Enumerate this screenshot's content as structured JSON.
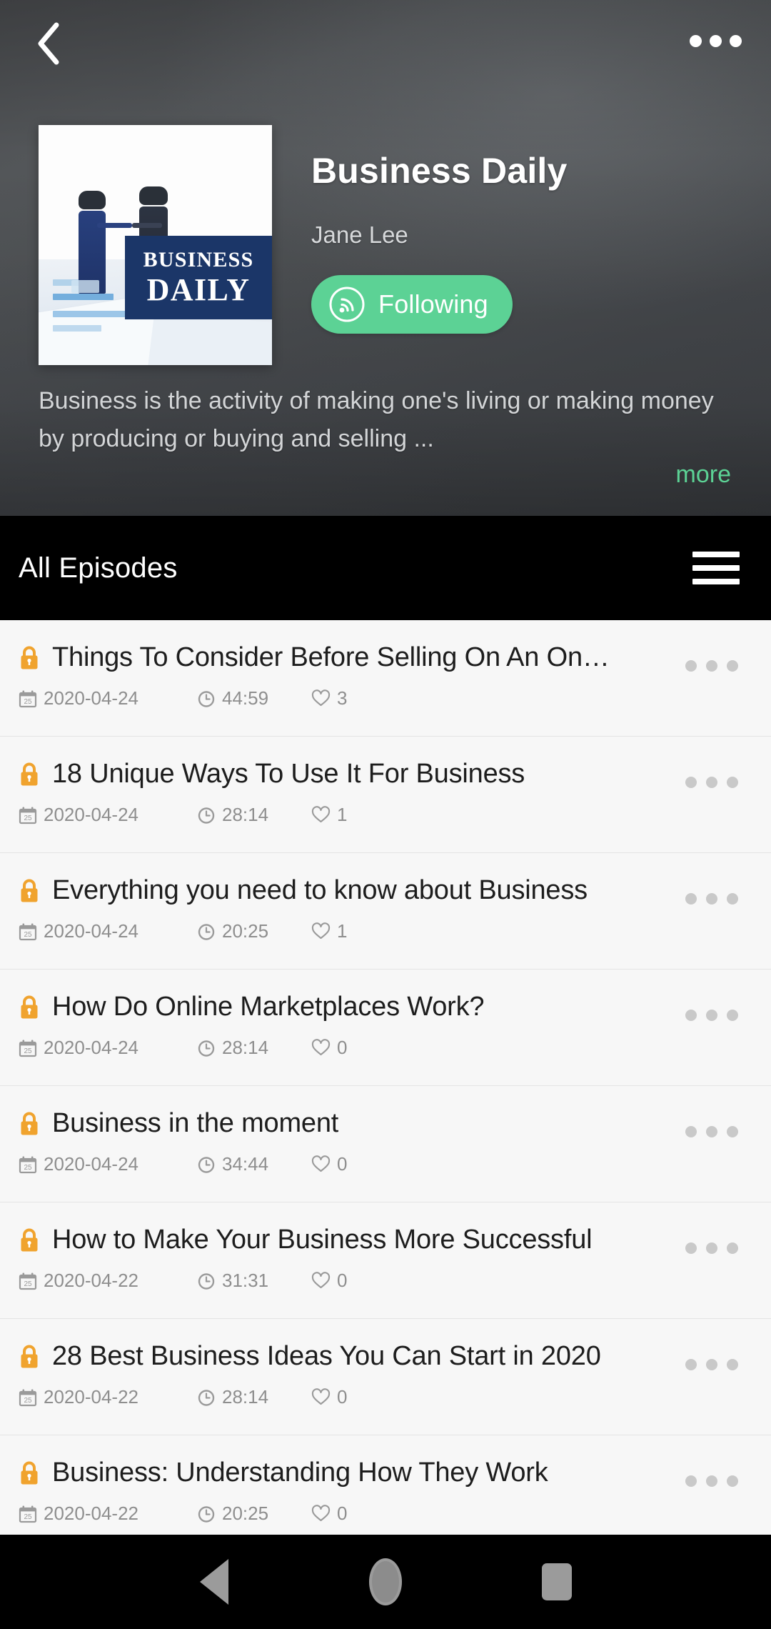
{
  "header": {
    "back_icon": "chevron-left-icon",
    "overflow_icon": "more-horizontal-icon",
    "cover_line1": "BUSINESS",
    "cover_line2": "DAILY",
    "podcast_title": "Business Daily",
    "author": "Jane Lee",
    "follow_label": "Following",
    "follow_icon": "rss-broadcast-icon",
    "description": "Business is the activity of making one's living or making money by producing or buying and selling ...",
    "more_label": "more",
    "accent_green": "#5cd295",
    "lock_orange": "#f0a32e"
  },
  "section": {
    "title": "All Episodes",
    "menu_icon": "hamburger-menu-icon"
  },
  "episodes": [
    {
      "title": "Things To Consider Before Selling On An On…",
      "date": "2020-04-24",
      "duration": "44:59",
      "likes": "3"
    },
    {
      "title": "18 Unique Ways To Use It For Business",
      "date": "2020-04-24",
      "duration": "28:14",
      "likes": "1"
    },
    {
      "title": "Everything you need to know about Business",
      "date": "2020-04-24",
      "duration": "20:25",
      "likes": "1"
    },
    {
      "title": "How Do Online Marketplaces Work?",
      "date": "2020-04-24",
      "duration": "28:14",
      "likes": "0"
    },
    {
      "title": "Business in the moment",
      "date": "2020-04-24",
      "duration": "34:44",
      "likes": "0"
    },
    {
      "title": "How to Make Your Business More Successful",
      "date": "2020-04-22",
      "duration": "31:31",
      "likes": "0"
    },
    {
      "title": "28 Best Business Ideas You Can Start in 2020",
      "date": "2020-04-22",
      "duration": "28:14",
      "likes": "0"
    },
    {
      "title": "Business: Understanding How They Work",
      "date": "2020-04-22",
      "duration": "20:25",
      "likes": "0"
    }
  ],
  "episode_icons": {
    "lock": "lock-icon",
    "date": "calendar-icon",
    "duration": "clock-icon",
    "likes": "heart-icon",
    "overflow": "more-horizontal-icon"
  },
  "navbar": {
    "back": "android-back-icon",
    "home": "android-home-icon",
    "recents": "android-recents-icon"
  }
}
